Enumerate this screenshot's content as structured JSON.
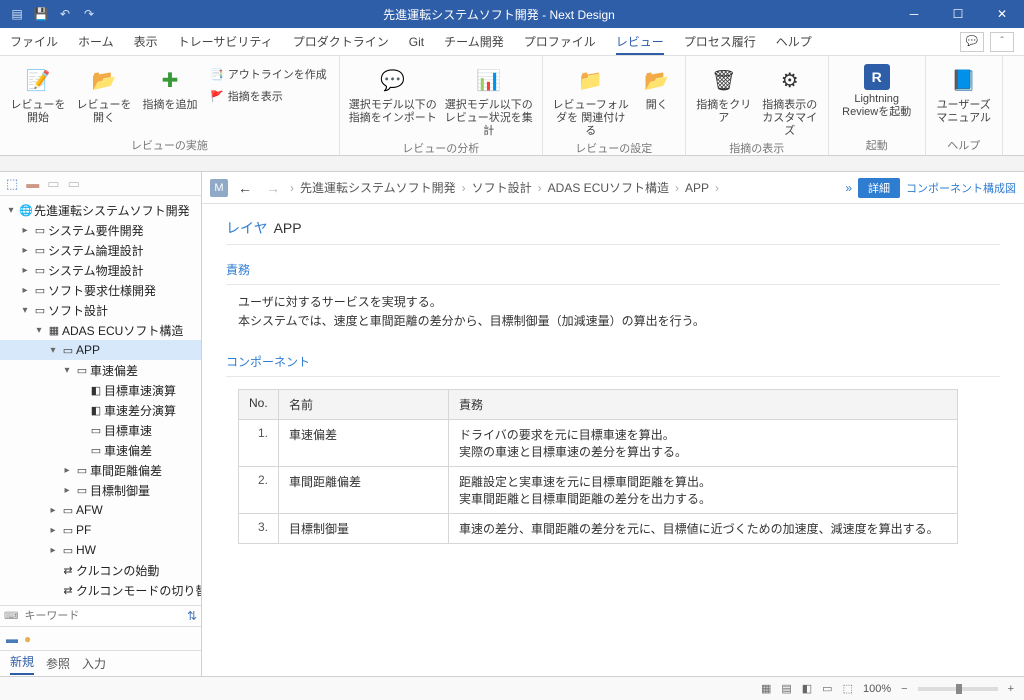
{
  "title": "先進運転システムソフト開発 - Next Design",
  "menu": [
    "ファイル",
    "ホーム",
    "表示",
    "トレーサビリティ",
    "プロダクトライン",
    "Git",
    "チーム開発",
    "プロファイル",
    "レビュー",
    "プロセス履行",
    "ヘルプ"
  ],
  "menu_active": 8,
  "ribbon": {
    "g1": {
      "title": "レビューの実施",
      "b1": "レビューを開始",
      "b2": "レビューを開く",
      "b3": "指摘を追加",
      "s1": "アウトラインを作成",
      "s2": "指摘を表示"
    },
    "g2": {
      "title": "レビューの分析",
      "b1": "選択モデル以下の\n指摘をインポート",
      "b2": "選択モデル以下の\nレビュー状況を集計"
    },
    "g3": {
      "title": "レビューの設定",
      "b1": "レビューフォルダを\n関連付ける",
      "b2": "開く"
    },
    "g4": {
      "title": "指摘の表示",
      "b1": "指摘をクリア",
      "b2": "指摘表示の\nカスタマイズ"
    },
    "g5": {
      "title": "起動",
      "b1": "Lightning\nReviewを起動"
    },
    "g6": {
      "title": "ヘルプ",
      "b1": "ユーザーズ\nマニュアル"
    }
  },
  "tree": [
    {
      "d": 0,
      "tw": "▾",
      "ic": "🌐",
      "lbl": "先進運転システムソフト開発"
    },
    {
      "d": 1,
      "tw": "▸",
      "ic": "▭",
      "lbl": "システム要件開発"
    },
    {
      "d": 1,
      "tw": "▸",
      "ic": "▭",
      "lbl": "システム論理設計"
    },
    {
      "d": 1,
      "tw": "▸",
      "ic": "▭",
      "lbl": "システム物理設計"
    },
    {
      "d": 1,
      "tw": "▸",
      "ic": "▭",
      "lbl": "ソフト要求仕様開発"
    },
    {
      "d": 1,
      "tw": "▾",
      "ic": "▭",
      "lbl": "ソフト設計"
    },
    {
      "d": 2,
      "tw": "▾",
      "ic": "▦",
      "lbl": "ADAS ECUソフト構造"
    },
    {
      "d": 3,
      "tw": "▾",
      "ic": "▭",
      "lbl": "APP",
      "sel": true
    },
    {
      "d": 4,
      "tw": "▾",
      "ic": "▭",
      "lbl": "車速偏差"
    },
    {
      "d": 5,
      "tw": "",
      "ic": "◧",
      "lbl": "目標車速演算"
    },
    {
      "d": 5,
      "tw": "",
      "ic": "◧",
      "lbl": "車速差分演算"
    },
    {
      "d": 5,
      "tw": "",
      "ic": "▭",
      "lbl": "目標車速"
    },
    {
      "d": 5,
      "tw": "",
      "ic": "▭",
      "lbl": "車速偏差"
    },
    {
      "d": 4,
      "tw": "▸",
      "ic": "▭",
      "lbl": "車間距離偏差"
    },
    {
      "d": 4,
      "tw": "▸",
      "ic": "▭",
      "lbl": "目標制御量"
    },
    {
      "d": 3,
      "tw": "▸",
      "ic": "▭",
      "lbl": "AFW"
    },
    {
      "d": 3,
      "tw": "▸",
      "ic": "▭",
      "lbl": "PF"
    },
    {
      "d": 3,
      "tw": "▸",
      "ic": "▭",
      "lbl": "HW"
    },
    {
      "d": 3,
      "tw": "",
      "ic": "⇄",
      "lbl": "クルコンの始動"
    },
    {
      "d": 3,
      "tw": "",
      "ic": "⇄",
      "lbl": "クルコンモードの切り替え"
    }
  ],
  "search_placeholder": "キーワード",
  "sb_tabs": [
    "新規",
    "参照",
    "入力"
  ],
  "crumbs": [
    "先進運転システムソフト開発",
    "ソフト設計",
    "ADAS ECUソフト構造",
    "APP"
  ],
  "detail_btn": "詳細",
  "comp_link": "コンポーネント構成図",
  "layer_label": "レイヤ",
  "layer_name": "APP",
  "sec1_title": "責務",
  "sec1_body1": "ユーザに対するサービスを実現する。",
  "sec1_body2": "本システムでは、速度と車間距離の差分から、目標制御量（加減速量）の算出を行う。",
  "sec2_title": "コンポーネント",
  "tbl_h": [
    "No.",
    "名前",
    "責務"
  ],
  "tbl": [
    {
      "no": "1.",
      "name": "車速偏差",
      "desc": "ドライバの要求を元に目標車速を算出。\n実際の車速と目標車速の差分を算出する。"
    },
    {
      "no": "2.",
      "name": "車間距離偏差",
      "desc": "距離設定と実車速を元に目標車間距離を算出。\n実車間距離と目標車間距離の差分を出力する。"
    },
    {
      "no": "3.",
      "name": "目標制御量",
      "desc": "車速の差分、車間距離の差分を元に、目標値に近づくための加速度、減速度を算出する。"
    }
  ],
  "status_zoom": "100%"
}
